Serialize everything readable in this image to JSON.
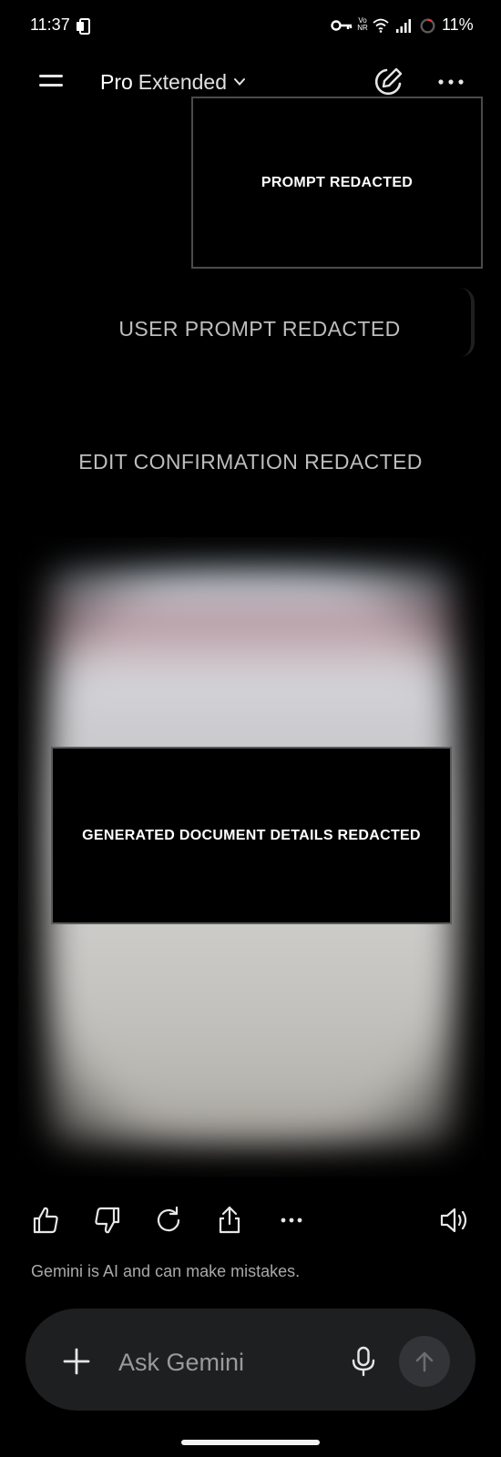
{
  "status_bar": {
    "time": "11:37",
    "vonr_label": "Vo NR",
    "battery_percent": "11%",
    "battery_level": 0.11,
    "battery_ring_color": "#e53935",
    "icons": [
      "phone-notification-icon",
      "vpn-key-icon",
      "vonr-icon",
      "wifi-icon",
      "cellular-signal-icon",
      "battery-ring-icon"
    ]
  },
  "top_bar": {
    "model_name": "Pro",
    "model_variant": "Extended",
    "icons": [
      "menu-icon",
      "chevron-down-icon",
      "new-chat-icon",
      "more-horizontal-icon"
    ]
  },
  "conversation": {
    "prompt_redacted": "PROMPT REDACTED",
    "user_prompt": "USER PROMPT REDACTED",
    "edit_confirmation": "EDIT CONFIRMATION REDACTED",
    "document_redacted": "GENERATED DOCUMENT DETAILS REDACTED"
  },
  "actions": {
    "icons": [
      "thumbs-up-icon",
      "thumbs-down-icon",
      "regenerate-icon",
      "share-icon",
      "more-horizontal-icon",
      "speaker-icon"
    ]
  },
  "disclaimer": "Gemini is AI and can make mistakes.",
  "input": {
    "placeholder": "Ask Gemini",
    "value": "",
    "icons": [
      "plus-icon",
      "mic-icon",
      "send-arrow-icon"
    ]
  },
  "colors": {
    "background": "#000000",
    "input_bar": "#1e1f20",
    "send_button": "#333437",
    "redaction_border": "#4b4b4b"
  }
}
